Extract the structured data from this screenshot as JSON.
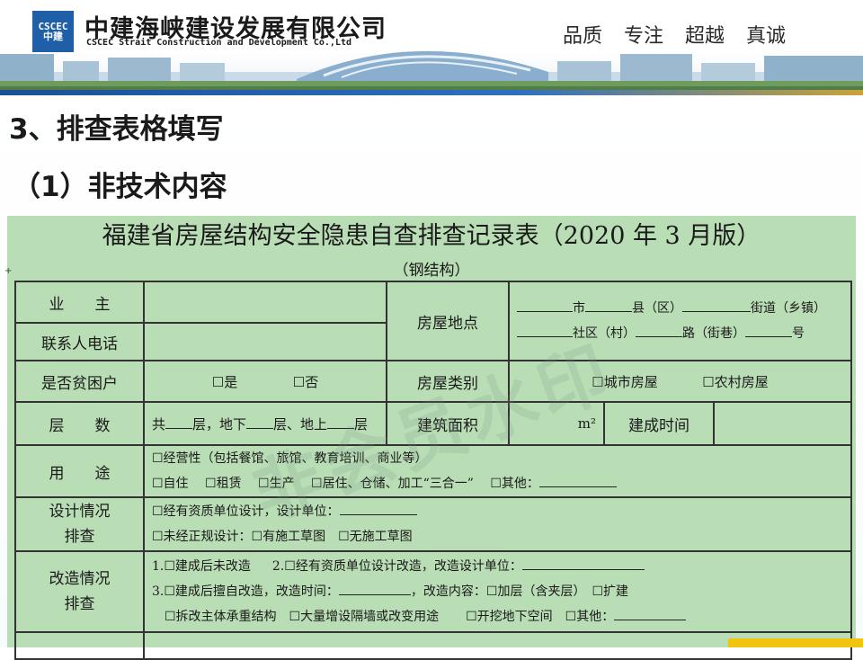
{
  "header": {
    "logo_text": [
      "CSCEC",
      "中建"
    ],
    "company_cn": "中建海峡建设发展有限公司",
    "company_en": "CSCEC Strait Construction and Development Co.,Ltd",
    "slogans": [
      "品质",
      "专注",
      "超越",
      "真诚"
    ]
  },
  "slide": {
    "section_title": "3、排查表格填写",
    "sub_title": "（1）非技术内容"
  },
  "form": {
    "title": "福建省房屋结构安全隐患自查排查记录表（2020 年 3 月版）",
    "subtitle": "（钢结构）",
    "watermark": "非会员水印",
    "rows": {
      "owner_label": "业　　主",
      "phone_label": "联系人电话",
      "location_label": "房屋地点",
      "loc_city": "市",
      "loc_county": "县（区）",
      "loc_street": "街道（乡镇）",
      "loc_community": "社区（村）",
      "loc_road": "路（街巷）",
      "loc_number": "号",
      "poor_label": "是否贫困户",
      "opt_yes": "☐是",
      "opt_no": "☐否",
      "type_label": "房屋类别",
      "opt_urban": "☐城市房屋",
      "opt_rural": "☐农村房屋",
      "floors_label": "层　　数",
      "floors_total": "共",
      "floors_ceng1": "层，地下",
      "floors_ceng2": "层、地上",
      "floors_ceng3": "层",
      "area_label": "建筑面积",
      "area_unit": "m²",
      "built_label": "建成时间",
      "usage_label": "用　　途",
      "usage_line1": "☐经营性（包括餐馆、旅馆、教育培训、商业等）",
      "usage_self": "☐自住",
      "usage_rent": "☐租赁",
      "usage_production": "☐生产",
      "usage_sanheyi": "☐居住、仓储、加工“三合一”",
      "usage_other": "☐其他：",
      "design_label_1": "设计情况",
      "design_label_2": "排查",
      "design_line1": "☐经有资质单位设计，设计单位：",
      "design_line2": "☐未经正规设计：☐有施工草图　☐无施工草图",
      "reno_label_1": "改造情况",
      "reno_label_2": "排查",
      "reno_1": "1.☐建成后未改造",
      "reno_2": "2.☐经有资质单位设计改造，改造设计单位：",
      "reno_3": "3.☐建成后擅自改造，改造时间：",
      "reno_3b": "，改造内容：☐加层（含夹层）　☐扩建",
      "reno_4": "☐拆改主体承重结构　☐大量增设隔墙或改变用途",
      "reno_5": "☐开挖地下空间　☐其他："
    }
  }
}
